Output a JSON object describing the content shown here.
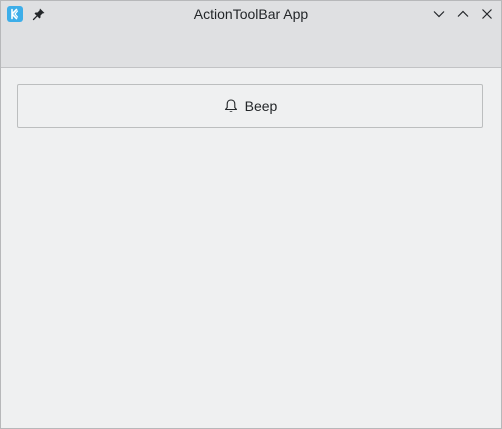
{
  "window": {
    "title": "ActionToolBar App",
    "controls": {
      "minimize_icon": "chevron-down-icon",
      "maximize_icon": "chevron-up-icon",
      "close_icon": "close-icon"
    },
    "app_icon": "kde-icon",
    "pin_icon": "pin-icon"
  },
  "toolbar": {
    "beep_label": "Beep",
    "beep_icon": "bell-icon"
  },
  "colors": {
    "window_bg": "#eff0f1",
    "header_bg": "#dfe0e2",
    "accent": "#3daee9",
    "text": "#232629"
  }
}
